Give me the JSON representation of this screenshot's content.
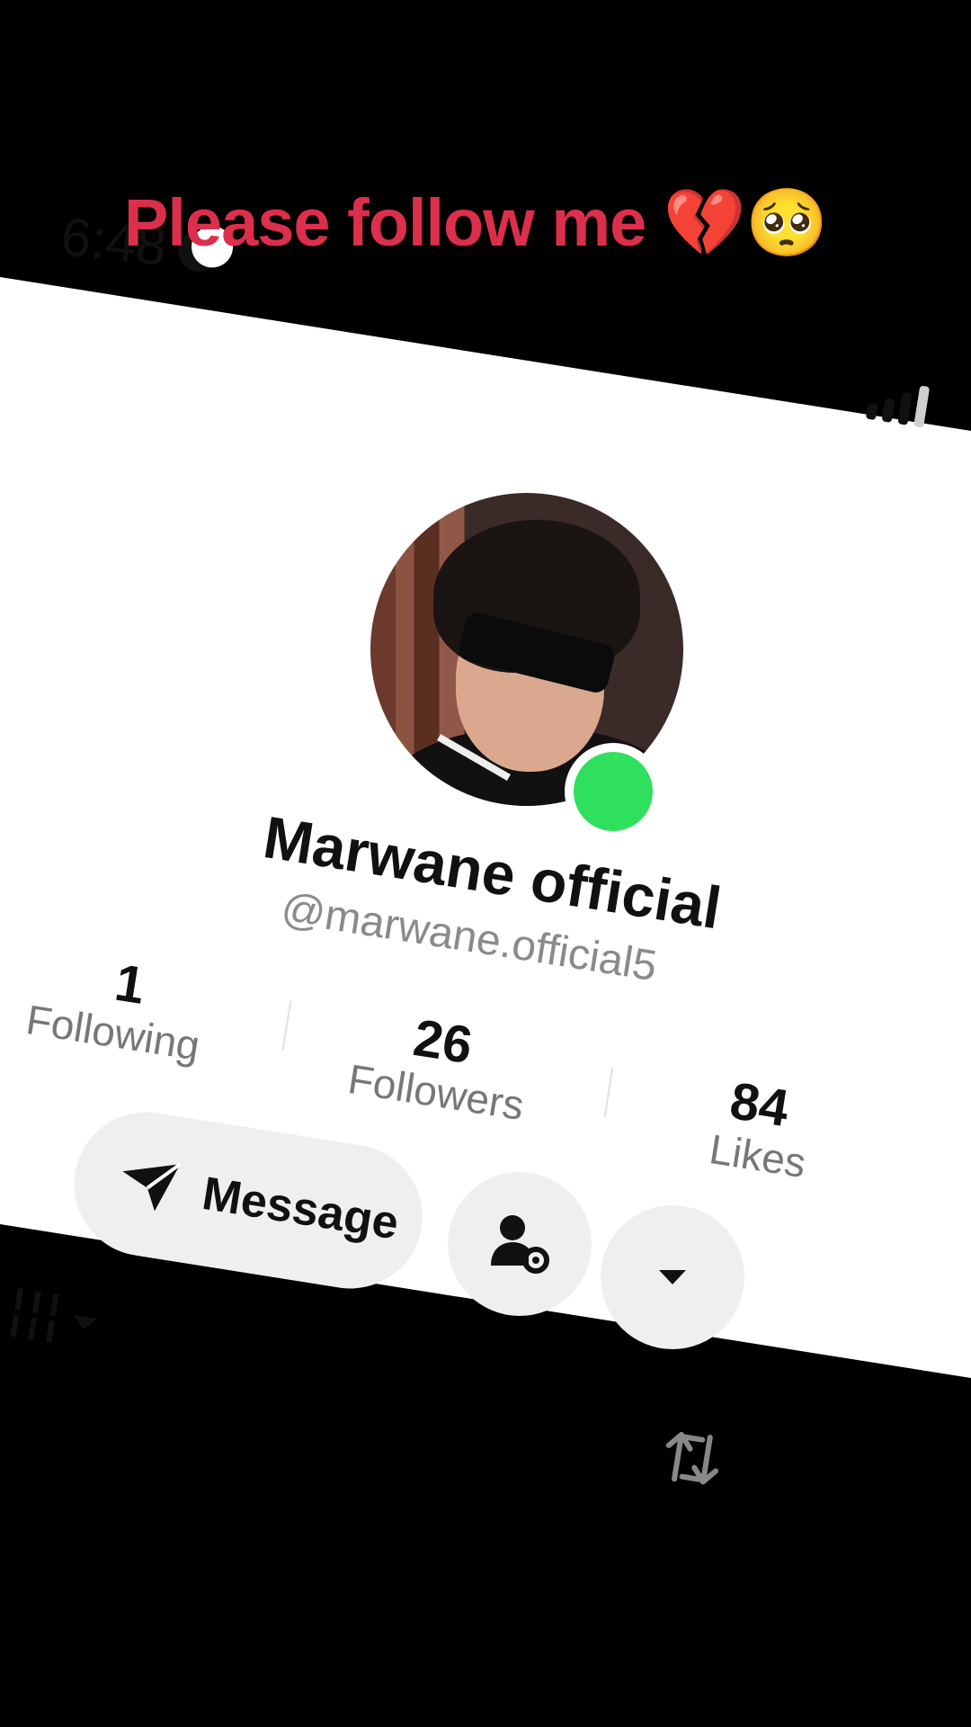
{
  "overlay": {
    "caption": "Please follow me 💔🥺"
  },
  "status_bar": {
    "time": "6:48",
    "icons": [
      "moon-icon",
      "signal-icon"
    ]
  },
  "profile": {
    "display_name": "Marwane official",
    "handle": "@marwane.official5",
    "online": true
  },
  "stats": [
    {
      "value": "1",
      "label": "Following"
    },
    {
      "value": "26",
      "label": "Followers"
    },
    {
      "value": "84",
      "label": "Likes"
    }
  ],
  "actions": {
    "message_label": "Message",
    "icons": [
      "send-icon",
      "user-settings-icon",
      "dropdown-icon"
    ]
  },
  "tabs": {
    "icons": [
      "grid-icon",
      "repost-icon"
    ]
  },
  "colors": {
    "caption": "#dc2f4c",
    "online": "#2fe05d",
    "button_bg": "#efefef"
  }
}
